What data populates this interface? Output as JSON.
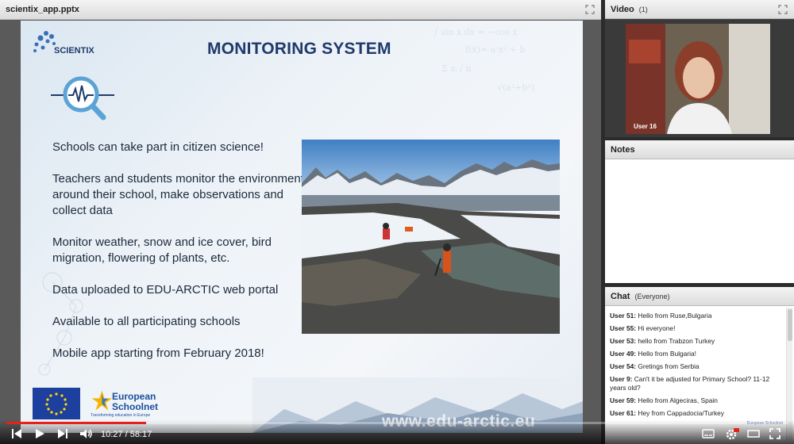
{
  "presentation": {
    "file_name": "scientix_app.pptx",
    "slide": {
      "title": "MONITORING SYSTEM",
      "logo_text": "SCIENTIX",
      "bullets": [
        "Schools can take part in citizen science!",
        "Teachers and students monitor the environment around their school, make observations and collect data",
        "Monitor weather, snow and ice cover, bird migration, flowering of plants, etc.",
        "Data uploaded to EDU-ARCTIC web portal",
        "Available to all participating schools",
        "Mobile app starting from February 2018!"
      ],
      "partner_name": "European Schoolnet",
      "partner_tagline": "Transforming education in Europe",
      "url": "www.edu-arctic.eu"
    }
  },
  "player": {
    "current_time": "10:27",
    "duration": "58:17",
    "time_display": "10:27 / 58:17",
    "progress_fraction": 0.179
  },
  "video_pod": {
    "title": "Video",
    "count": "(1)",
    "speaker_label": "User 16"
  },
  "notes_pod": {
    "title": "Notes"
  },
  "chat_pod": {
    "title": "Chat",
    "scope": "(Everyone)",
    "messages": [
      {
        "user": "User 51:",
        "text": "Hello from Ruse,Bulgaria"
      },
      {
        "user": "User 55:",
        "text": "Hi everyone!"
      },
      {
        "user": "User 53:",
        "text": "hello from Trabzon Turkey"
      },
      {
        "user": "User 49:",
        "text": "Hello from Bulgaria!"
      },
      {
        "user": "User 54:",
        "text": "Gretings from  Serbia"
      },
      {
        "user": "User 9:",
        "text": "Can't it be adjusted for Primary School? 11-12 years old?"
      },
      {
        "user": "User 59:",
        "text": "Hello from Algeciras, Spain"
      },
      {
        "user": "User 61:",
        "text": "Hey from Cappadocia/Turkey"
      }
    ]
  },
  "colors": {
    "title_blue": "#1f3a6b",
    "progress_red": "#e62117"
  }
}
